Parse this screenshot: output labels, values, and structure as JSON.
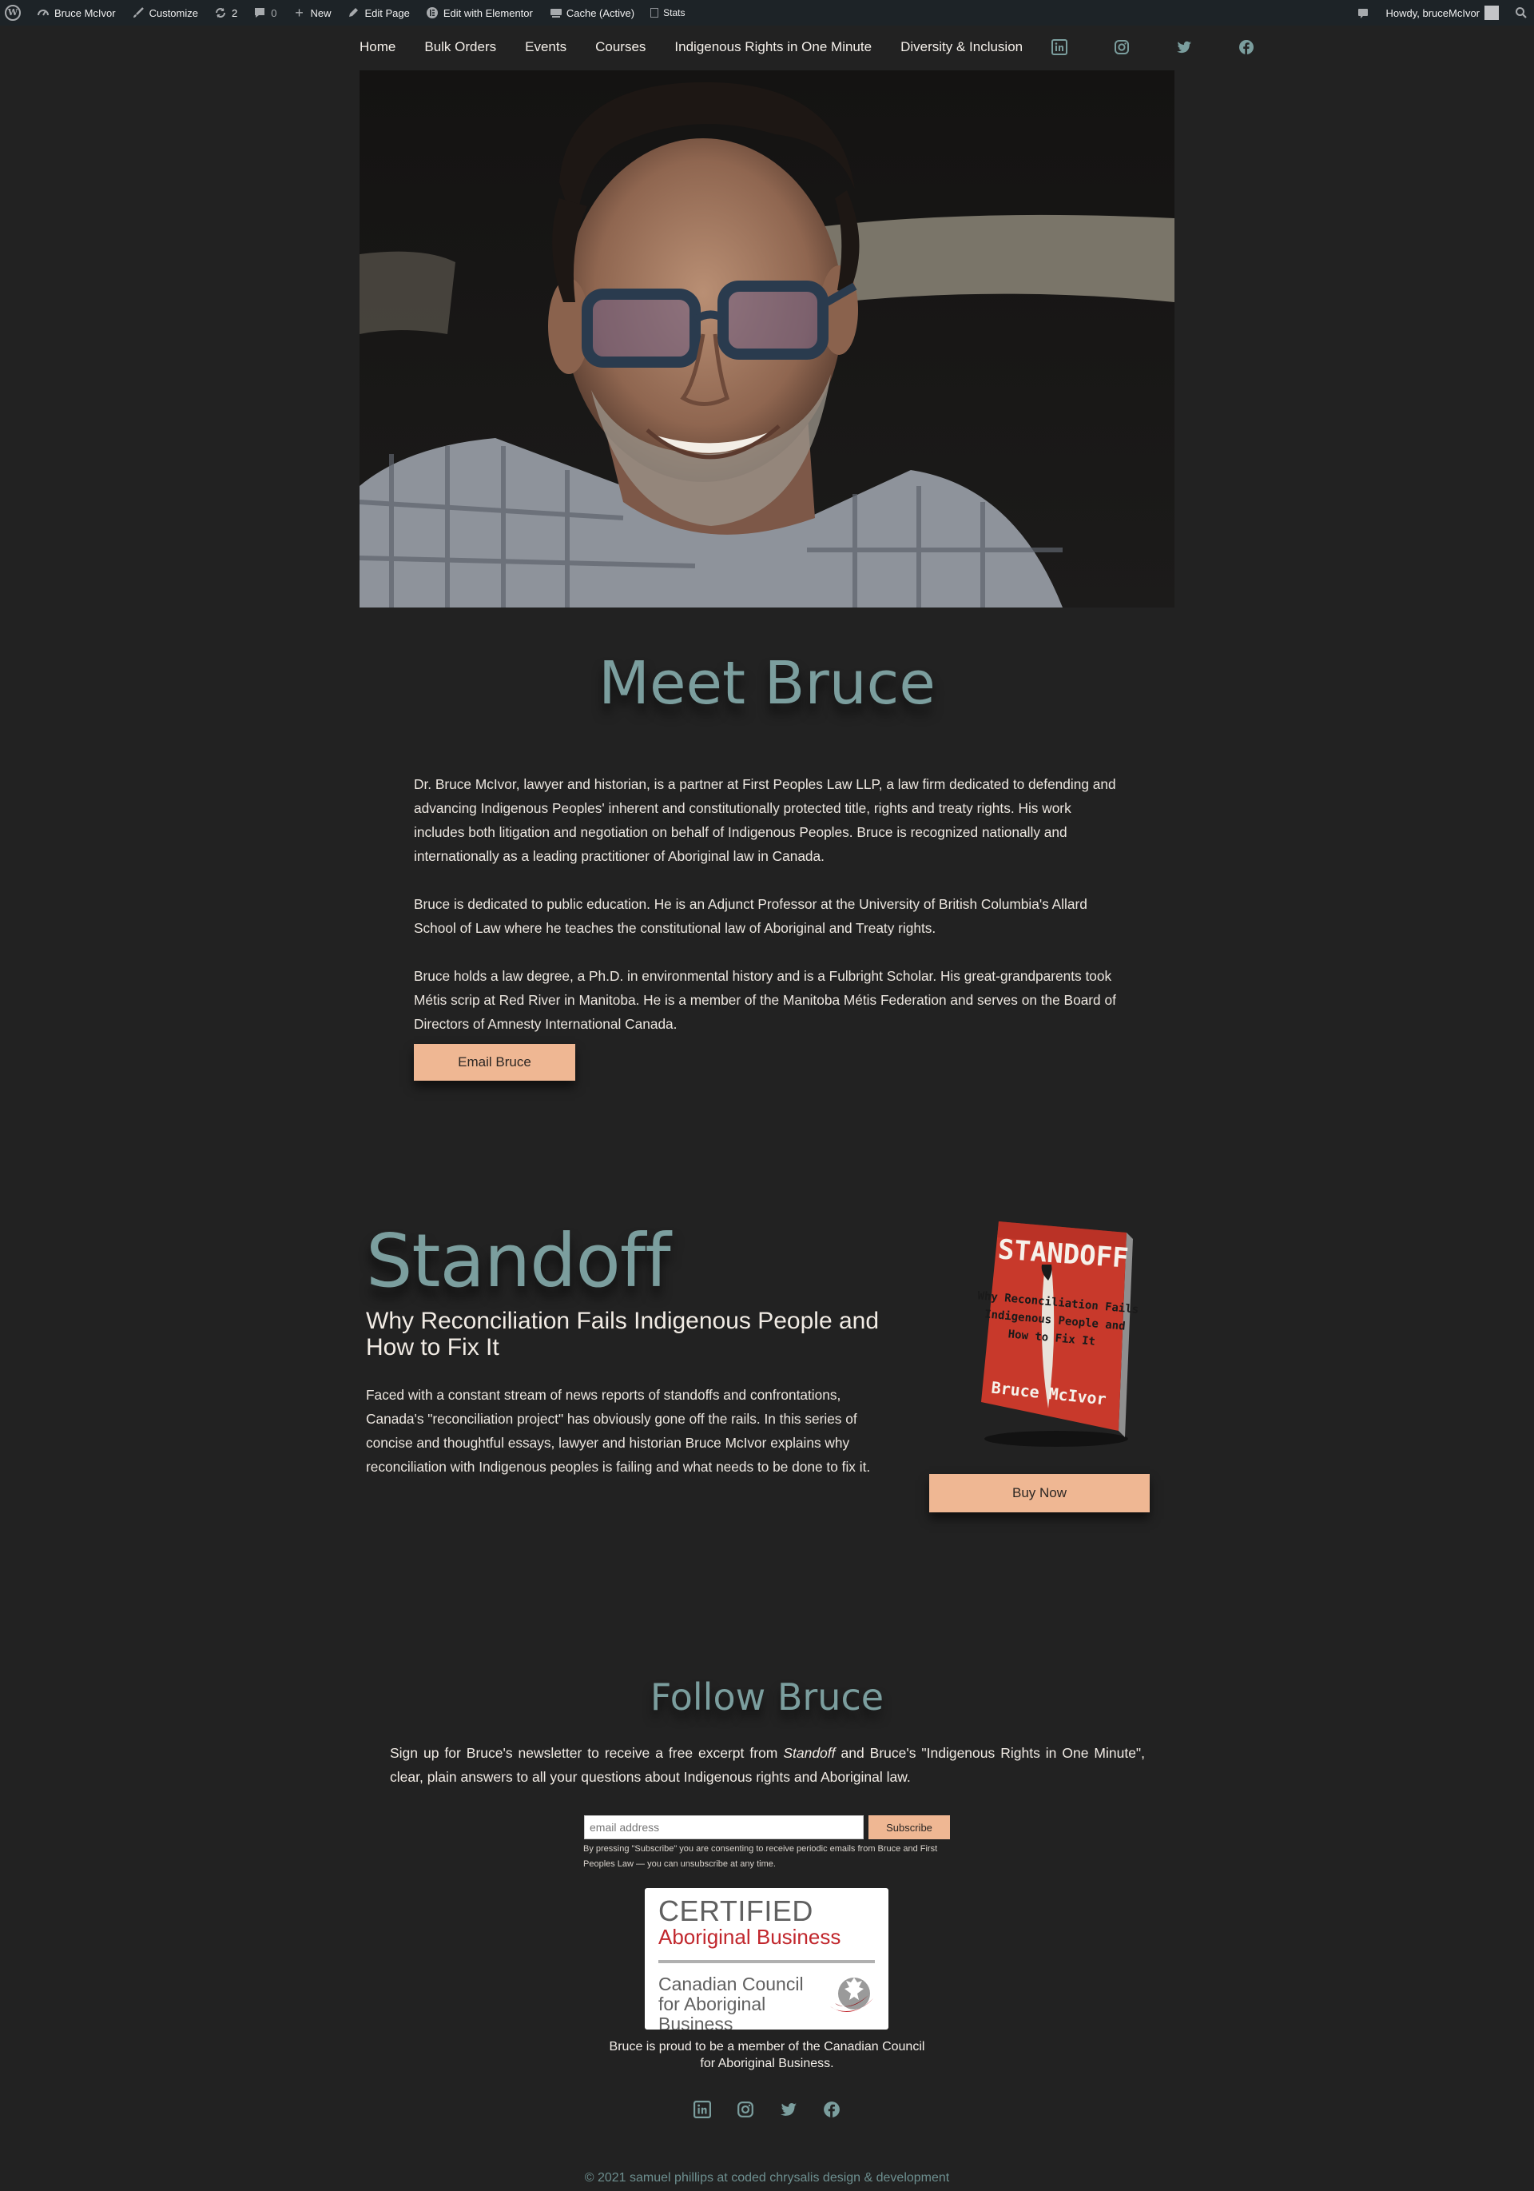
{
  "admin_bar": {
    "site_name": "Bruce McIvor",
    "customize": "Customize",
    "updates_count": "2",
    "comments_count": "0",
    "new": "New",
    "edit_page": "Edit Page",
    "edit_elementor": "Edit with Elementor",
    "cache": "Cache (Active)",
    "stats": "Stats",
    "howdy": "Howdy, bruceMcIvor"
  },
  "nav": {
    "items": [
      "Home",
      "Bulk Orders",
      "Events",
      "Courses",
      "Indigenous Rights in One Minute",
      "Diversity & Inclusion"
    ],
    "social_icons": [
      "linkedin-icon",
      "instagram-icon",
      "twitter-icon",
      "facebook-icon"
    ]
  },
  "meet": {
    "title": "Meet Bruce",
    "paragraphs": [
      "Dr. Bruce McIvor, lawyer and historian, is a partner at First Peoples Law LLP, a law firm dedicated to defending and advancing Indigenous Peoples' inherent and constitutionally protected title, rights and treaty rights. His work includes both litigation and negotiation on behalf of Indigenous Peoples. Bruce is recognized nationally and internationally as a leading practitioner of Aboriginal law in Canada.",
      "Bruce is dedicated to public education. He is an Adjunct Professor at the University of British Columbia's Allard School of Law where he teaches the constitutional law of Aboriginal and Treaty rights.",
      "Bruce holds a law degree, a Ph.D. in environmental history and is a Fulbright Scholar. His great-grandparents took Métis scrip at Red River in Manitoba. He is a member of the Manitoba Métis Federation and serves on the Board of Directors of Amnesty International Canada."
    ],
    "email_button": "Email Bruce"
  },
  "book": {
    "title": "Standoff",
    "subtitle": "Why Reconciliation Fails Indigenous People and How to Fix It",
    "description": "Faced with a constant stream of news reports of standoffs and confrontations, Canada's \"reconciliation project\" has obviously gone off the rails. In this series of concise and thoughtful essays, lawyer and historian Bruce McIvor explains why reconciliation with Indigenous peoples is failing and what needs to be done to fix it.",
    "cover_title": "STANDOFF",
    "cover_subtitle_lines": [
      "Why Reconciliation Fails",
      "Indigenous People and",
      "How to Fix It"
    ],
    "cover_author": "Bruce McIvor",
    "buy_button": "Buy Now"
  },
  "follow": {
    "title": "Follow Bruce",
    "signup_pre": "Sign up for Bruce's newsletter to receive a free excerpt from ",
    "signup_em": "Standoff",
    "signup_post": " and Bruce's \"Indigenous Rights in One Minute\", clear, plain answers to all your questions about Indigenous rights and Aboriginal law.",
    "email_placeholder": "email address",
    "subscribe_button": "Subscribe",
    "consent": "By pressing \"Subscribe\" you are consenting to receive periodic emails from Bruce and First Peoples Law — you can unsubscribe at any time."
  },
  "certification": {
    "line1": "CERTIFIED",
    "line2": "Aboriginal Business",
    "line3": "Canadian Council for Aboriginal Business",
    "caption": "Bruce is proud to be a member of the Canadian Council for Aboriginal Business."
  },
  "footer": {
    "copyright": "© 2021 samuel phillips at coded chrysalis design & development"
  },
  "colors": {
    "background": "#222222",
    "accent_teal": "#7b9e9e",
    "button_peach": "#efb793",
    "admin_bar": "#1d2327"
  }
}
